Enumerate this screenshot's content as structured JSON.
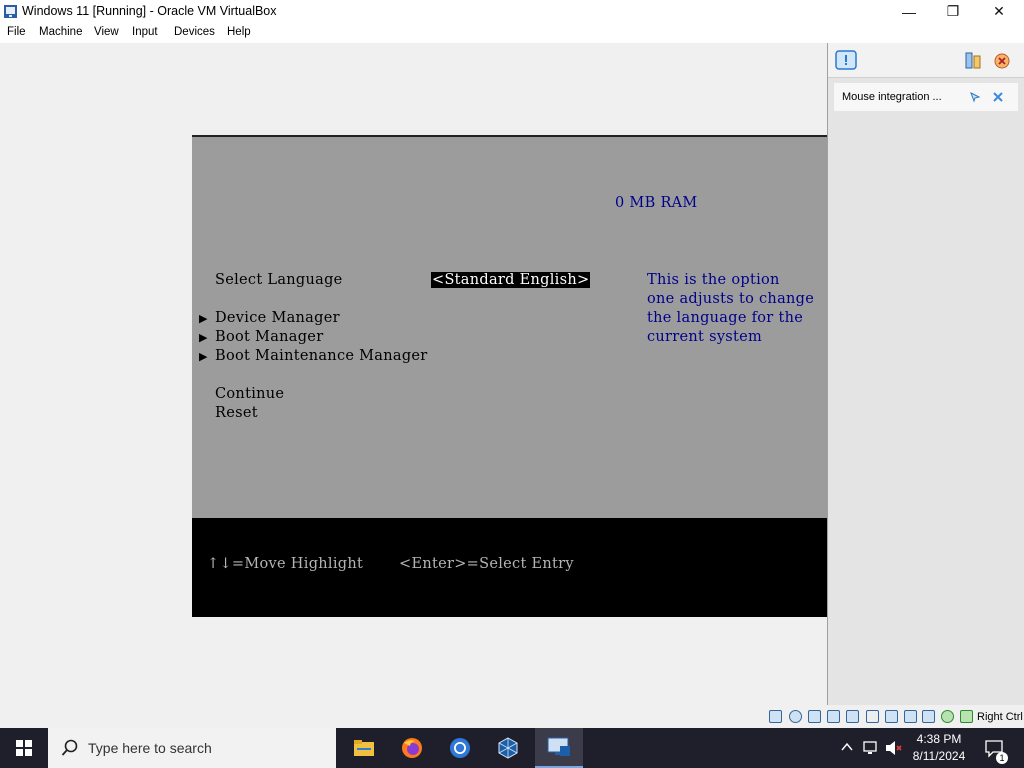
{
  "window": {
    "title": "Windows 11 [Running] - Oracle VM VirtualBox",
    "minimize_glyph": "—",
    "maximize_glyph": "❐",
    "close_glyph": "✕"
  },
  "menu": [
    "File",
    "Machine",
    "View",
    "Input",
    "Devices",
    "Help"
  ],
  "bios": {
    "ram": "0 MB RAM",
    "select_language_label": "Select Language",
    "select_language_value": "<Standard English>",
    "help_lines": [
      "This is the option",
      "one adjusts to change",
      "the language for the",
      "current system"
    ],
    "menu_items": [
      "Device Manager",
      "Boot Manager",
      "Boot Maintenance Manager"
    ],
    "actions": [
      "Continue",
      "Reset"
    ],
    "footer_hint_move": "↑↓=Move Highlight",
    "footer_hint_enter": "<Enter>=Select Entry",
    "colors": {
      "background": "#9c9c9c",
      "help_text": "#00008b",
      "footer": "#000000"
    }
  },
  "side_panel": {
    "notification": "Mouse integration ..."
  },
  "status_bar": {
    "host_key": "Right Ctrl"
  },
  "taskbar": {
    "search_placeholder": "Type here to search",
    "time": "4:38 PM",
    "date": "8/11/2024",
    "notification_count": "1",
    "apps": [
      "file-explorer-icon",
      "firefox-icon",
      "chrome-icon",
      "virtualbox-icon",
      "virtualbox-vm-icon"
    ]
  }
}
